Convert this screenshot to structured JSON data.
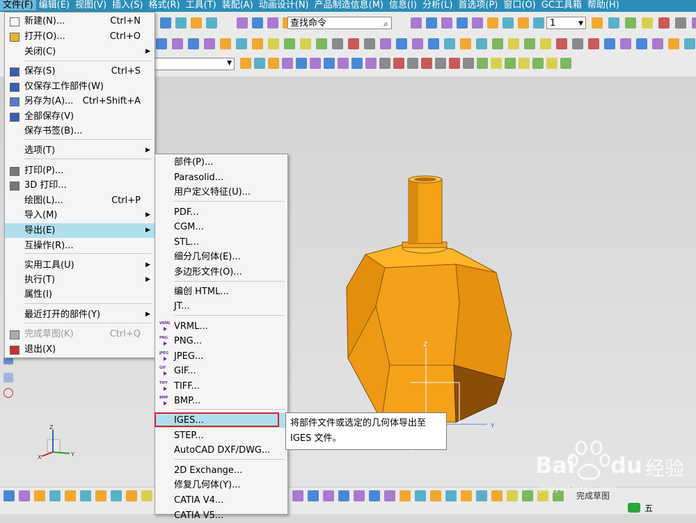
{
  "menubar": [
    "文件(F)",
    "编辑(E)",
    "视图(V)",
    "插入(S)",
    "格式(R)",
    "工具(T)",
    "装配(A)",
    "动画设计(N)",
    "产品制造信息(M)",
    "信息(I)",
    "分析(L)",
    "首选项(P)",
    "窗口(O)",
    "GC工具箱",
    "帮助(H)"
  ],
  "toolbar": {
    "command_finder_label": "查找命令",
    "layer_number": "1"
  },
  "file_menu": {
    "items": [
      {
        "label": "新建(N)...",
        "shortcut": "Ctrl+N",
        "icon": "new-file-icon"
      },
      {
        "label": "打开(O)...",
        "shortcut": "Ctrl+O",
        "icon": "open-folder-icon"
      },
      {
        "label": "关闭(C)",
        "arrow": "▶"
      },
      {
        "label": "保存(S)",
        "shortcut": "Ctrl+S",
        "icon": "save-icon"
      },
      {
        "label": "仅保存工作部件(W)",
        "icon": "save-work-part-icon"
      },
      {
        "label": "另存为(A)...",
        "shortcut": "Ctrl+Shift+A",
        "icon": "save-as-icon"
      },
      {
        "label": "全部保存(V)",
        "icon": "save-all-icon"
      },
      {
        "label": "保存书签(B)..."
      },
      {
        "label": "选项(T)",
        "arrow": "▶"
      },
      {
        "label": "打印(P)...",
        "icon": "print-icon"
      },
      {
        "label": "3D 打印...",
        "icon": "3d-print-icon"
      },
      {
        "label": "绘图(L)...",
        "shortcut": "Ctrl+P"
      },
      {
        "label": "导入(M)",
        "arrow": "▶"
      },
      {
        "label": "导出(E)",
        "arrow": "▶"
      },
      {
        "label": "互操作(R)..."
      },
      {
        "label": "实用工具(U)",
        "arrow": "▶"
      },
      {
        "label": "执行(T)",
        "arrow": "▶"
      },
      {
        "label": "属性(I)"
      },
      {
        "label": "最近打开的部件(Y)",
        "arrow": "▶"
      },
      {
        "label": "完成草图(K)",
        "shortcut": "Ctrl+Q",
        "icon": "finish-sketch-icon"
      },
      {
        "label": "退出(X)",
        "icon": "exit-icon"
      }
    ]
  },
  "export_menu": {
    "items": [
      {
        "label": "部件(P)..."
      },
      {
        "label": "Parasolid..."
      },
      {
        "label": "用户定义特征(U)..."
      },
      {
        "label": "PDF..."
      },
      {
        "label": "CGM..."
      },
      {
        "label": "STL..."
      },
      {
        "label": "细分几何体(E)..."
      },
      {
        "label": "多边形文件(O)..."
      },
      {
        "label": "编创 HTML..."
      },
      {
        "label": "JT..."
      },
      {
        "label": "VRML...",
        "tag": "VRML"
      },
      {
        "label": "PNG...",
        "tag": "PNG"
      },
      {
        "label": "JPEG...",
        "tag": "JPEG"
      },
      {
        "label": "GIF...",
        "tag": "GIF"
      },
      {
        "label": "TIFF...",
        "tag": "TIFF"
      },
      {
        "label": "BMP...",
        "tag": "BMP"
      },
      {
        "label": "IGES..."
      },
      {
        "label": "STEP..."
      },
      {
        "label": "AutoCAD DXF/DWG..."
      },
      {
        "label": "2D Exchange..."
      },
      {
        "label": "修复几何体(Y)..."
      },
      {
        "label": "CATIA V4..."
      },
      {
        "label": "CATIA V5..."
      }
    ]
  },
  "tooltip": {
    "line1": "将部件文件或选定的几何体导出至",
    "line2": "IGES 文件。"
  },
  "axes": {
    "x": "X",
    "y": "Y",
    "z": "Z"
  },
  "watermark": {
    "brand": "Bai",
    "brand2": "du",
    "suffix": "经验",
    "url": "jingyan.baidu.com"
  },
  "status": {
    "sketch_label": "完成草图",
    "ime_label": "五"
  },
  "colors": {
    "accent": "#2a8db8",
    "highlight": "#aee0ee",
    "model": "#f5a21a",
    "error": "#e0192a"
  }
}
